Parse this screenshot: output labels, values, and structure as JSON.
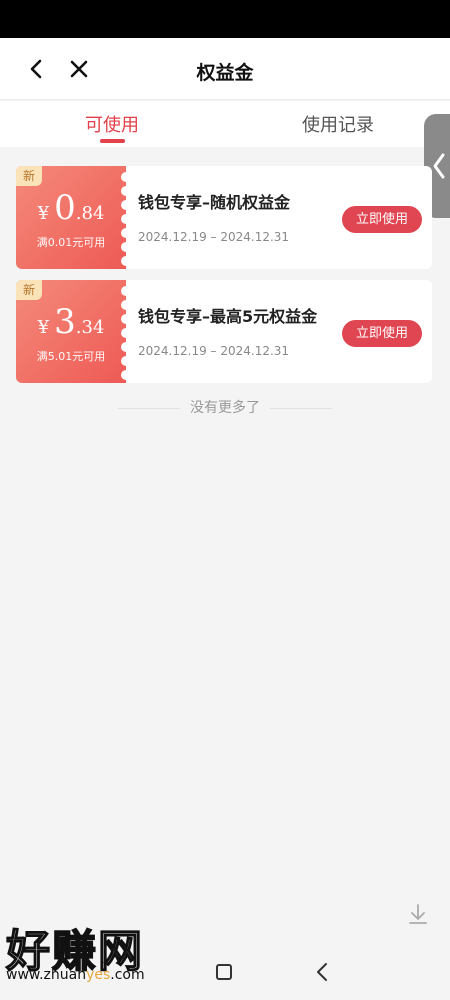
{
  "header": {
    "title": "权益金"
  },
  "tabs": [
    {
      "label": "可使用",
      "active": true
    },
    {
      "label": "使用记录",
      "active": false
    }
  ],
  "coupons": [
    {
      "badge": "新",
      "currency": "¥",
      "amount_int": "0",
      "amount_dec": ".84",
      "condition": "满0.01元可用",
      "title": "钱包专享–随机权益金",
      "date_range": "2024.12.19 – 2024.12.31",
      "button": "立即使用"
    },
    {
      "badge": "新",
      "currency": "¥",
      "amount_int": "3",
      "amount_dec": ".34",
      "condition": "满5.01元可用",
      "title": "钱包专享–最高5元权益金",
      "date_range": "2024.12.19 – 2024.12.31",
      "button": "立即使用"
    }
  ],
  "footer_text": "没有更多了",
  "watermark": {
    "text": "好赚网",
    "url_pre": "www.zhuan",
    "url_hl": "yes",
    "url_post": ".com"
  },
  "colors": {
    "accent": "#e0414a",
    "coupon_gradient_start": "#f48a7a",
    "coupon_gradient_end": "#ee5a55",
    "badge_bg": "#fbe3b9"
  }
}
